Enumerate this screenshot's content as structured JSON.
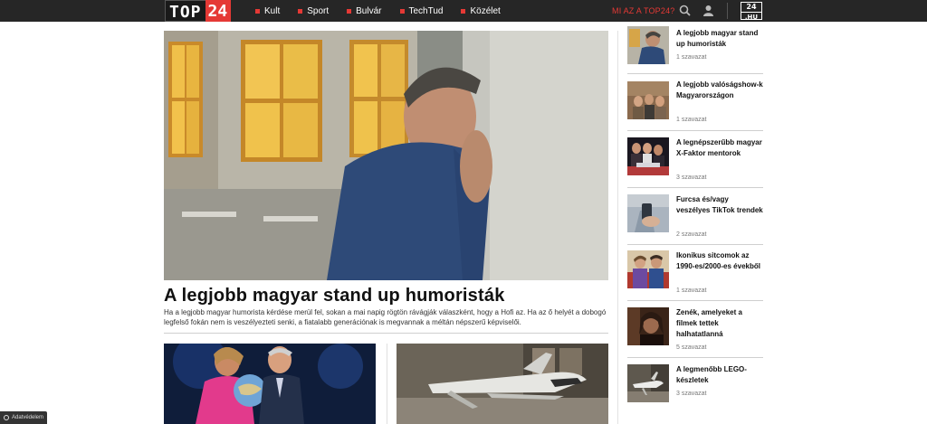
{
  "header": {
    "logo_left": "TOP",
    "logo_right": "24",
    "nav": [
      "Kult",
      "Sport",
      "Bulvár",
      "TechTud",
      "Közélet"
    ],
    "about_link": "MI AZ A TOP24?",
    "badge_top": "24",
    "badge_bottom": ".HU",
    "colors": {
      "bar": "#262626",
      "accent": "#e53935"
    }
  },
  "hero": {
    "title": "A legjobb magyar stand up humoristák",
    "excerpt": "Ha a legjobb magyar humorista kérdése merül fel, sokan a mai napig rögtön rávágják válaszként, hogy a Hofi az. Ha az ő helyét a dobogó legfelső fokán nem is veszélyezteti senki, a fiatalabb generációnak is megvannak a méltán népszerű képviselői."
  },
  "sidebar": {
    "items": [
      {
        "title": "A legjobb magyar stand up humoristák",
        "votes": "1 szavazat"
      },
      {
        "title": "A legjobb valóságshow-k Magyarországon",
        "votes": "1 szavazat"
      },
      {
        "title": "A legnépszerűbb magyar X-Faktor mentorok",
        "votes": "3 szavazat"
      },
      {
        "title": "Furcsa és/vagy veszélyes TikTok trendek",
        "votes": "2 szavazat"
      },
      {
        "title": "Ikonikus sitcomok az 1990-es/2000-es évekből",
        "votes": "1 szavazat"
      },
      {
        "title": "Zenék, amelyeket a filmek tettek halhatatlanná",
        "votes": "5 szavazat"
      },
      {
        "title": "A legmenőbb LEGO-készletek",
        "votes": "3 szavazat"
      }
    ]
  },
  "privacy": {
    "label": "Adatvédelem"
  }
}
